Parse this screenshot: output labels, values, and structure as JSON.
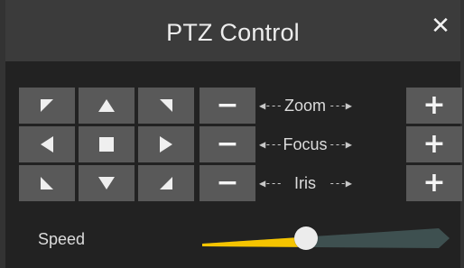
{
  "window": {
    "title": "PTZ Control",
    "close_label": "✕"
  },
  "pad": {
    "buttons": [
      "up-left",
      "up",
      "up-right",
      "left",
      "stop",
      "right",
      "down-left",
      "down",
      "down-right"
    ]
  },
  "controls": [
    {
      "name": "Zoom",
      "minus": "−",
      "plus": "+",
      "left_arrow": "◀---",
      "right_arrow": "---▶"
    },
    {
      "name": "Focus",
      "minus": "−",
      "plus": "+",
      "left_arrow": "◀---",
      "right_arrow": "---▶"
    },
    {
      "name": "Iris",
      "minus": "−",
      "plus": "+",
      "left_arrow": "◀---",
      "right_arrow": "---▶"
    }
  ],
  "speed": {
    "label": "Speed",
    "value": 0.44
  },
  "colors": {
    "accent": "#f5c400",
    "track": "#3e5050",
    "button": "#595959"
  }
}
